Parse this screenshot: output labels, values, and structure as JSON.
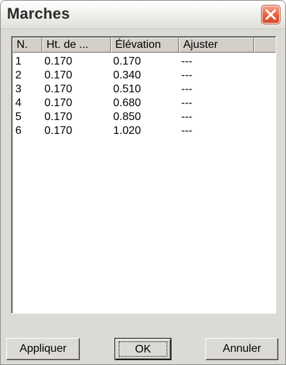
{
  "window": {
    "title": "Marches"
  },
  "columns": [
    "N.",
    "Ht. de ...",
    "Élévation",
    "Ajuster"
  ],
  "rows": [
    [
      "1",
      "0.170",
      "0.170",
      "---"
    ],
    [
      "2",
      "0.170",
      "0.340",
      "---"
    ],
    [
      "3",
      "0.170",
      "0.510",
      "---"
    ],
    [
      "4",
      "0.170",
      "0.680",
      "---"
    ],
    [
      "5",
      "0.170",
      "0.850",
      "---"
    ],
    [
      "6",
      "0.170",
      "1.020",
      "---"
    ]
  ],
  "buttons": {
    "apply": "Appliquer",
    "ok": "OK",
    "cancel": "Annuler"
  },
  "icons": {
    "close": "close-icon"
  },
  "colors": {
    "close_button": "#e4603c"
  }
}
